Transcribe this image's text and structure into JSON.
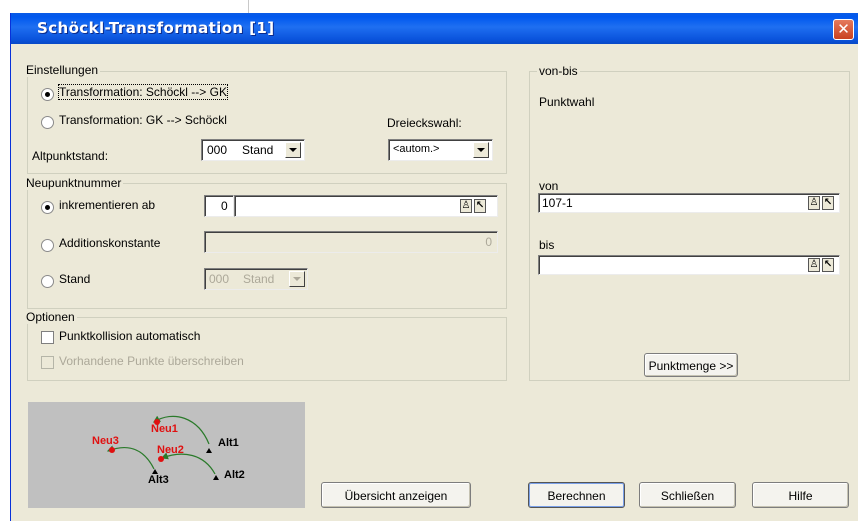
{
  "window": {
    "title": "Schöckl-Transformation [1]",
    "close_glyph": "✕"
  },
  "einstellungen": {
    "title": "Einstellungen",
    "radio_schoeckl_gk": "Transformation: Schöckl --> GK",
    "radio_gk_schoeckl": "Transformation: GK --> Schöckl",
    "dreieckswahl_label": "Dreieckswahl:",
    "dreieckswahl_value": "<autom.>",
    "altpunktstand_label": "Altpunktstand:",
    "altpunktstand_num": "000",
    "altpunktstand_text": "Stand"
  },
  "neupunktnummer": {
    "title": "Neupunktnummer",
    "radio_inkrementieren": "inkrementieren ab",
    "inkrementieren_value": "0",
    "radio_additionskonstante": "Additionskonstante",
    "additionskonstante_value": "0",
    "radio_stand": "Stand",
    "stand_num": "000",
    "stand_text": "Stand"
  },
  "optionen": {
    "title": "Optionen",
    "check_punktkollision": "Punktkollision automatisch",
    "check_vorhandene": "Vorhandene Punkte überschreiben"
  },
  "vonbis": {
    "title": "von-bis",
    "punktwahl_label": "Punktwahl",
    "von_label": "von",
    "von_value": "107-1",
    "bis_label": "bis",
    "bis_value": "",
    "punktmenge_button": "Punktmenge >>"
  },
  "diagram": {
    "neu1": "Neu1",
    "neu2": "Neu2",
    "neu3": "Neu3",
    "alt1": "Alt1",
    "alt2": "Alt2",
    "alt3": "Alt3",
    "colors": {
      "neu": "#e01010",
      "arrow": "#2a7a2a",
      "alt": "#000000",
      "bg": "#c0c0c0"
    }
  },
  "buttons": {
    "uebersicht": "Übersicht anzeigen",
    "berechnen": "Berechnen",
    "schliessen": "Schließen",
    "hilfe": "Hilfe"
  },
  "icons": {
    "pick": "point-picker-icon",
    "select": "cursor-select-icon"
  }
}
